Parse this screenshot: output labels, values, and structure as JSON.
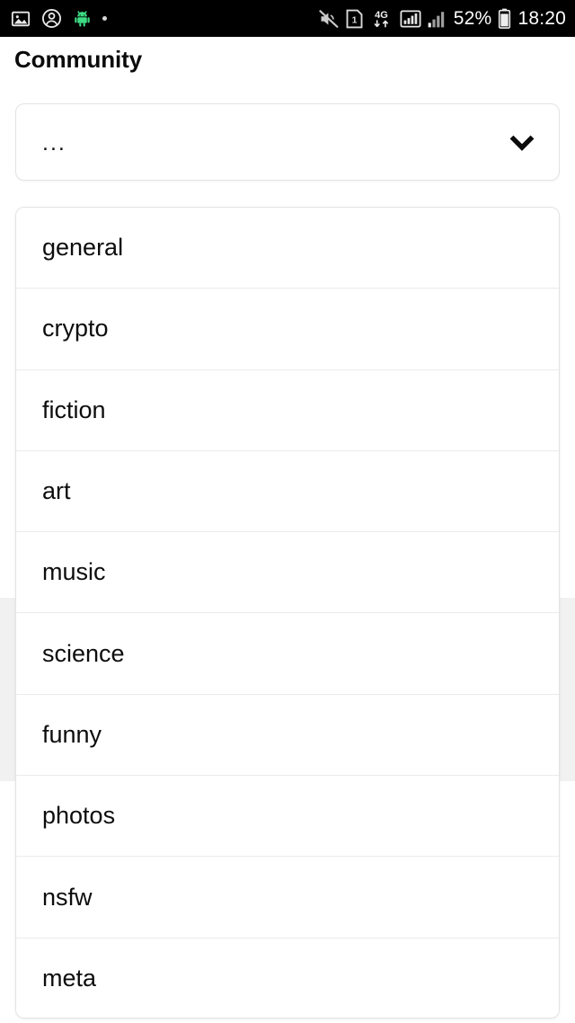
{
  "statusbar": {
    "left_icons": [
      {
        "name": "image-icon",
        "glyph": "photo"
      },
      {
        "name": "account-circle-icon",
        "glyph": "person"
      },
      {
        "name": "android-robot-icon",
        "glyph": "robot"
      },
      {
        "name": "notification-dot-icon",
        "glyph": "dot"
      }
    ],
    "right_icons": [
      {
        "name": "volume-off-icon",
        "glyph": "mute"
      },
      {
        "name": "sim-card-1-icon",
        "glyph": "sim",
        "label": "1"
      },
      {
        "name": "mobile-data-4g-icon",
        "glyph": "4g",
        "label": "4G"
      },
      {
        "name": "signal-bars-outline-icon",
        "glyph": "signal-outline"
      },
      {
        "name": "signal-bars-icon",
        "glyph": "signal"
      }
    ],
    "battery_percent": "52%",
    "battery_icon": "battery-icon",
    "clock": "18:20"
  },
  "header": {
    "title": "Community"
  },
  "select": {
    "name": "community-select",
    "value": "...",
    "chevron_icon": "chevron-down-icon"
  },
  "dropdown": {
    "name": "community-dropdown-list",
    "options": [
      {
        "label": "general"
      },
      {
        "label": "crypto"
      },
      {
        "label": "fiction"
      },
      {
        "label": "art"
      },
      {
        "label": "music"
      },
      {
        "label": "science"
      },
      {
        "label": "funny"
      },
      {
        "label": "photos"
      },
      {
        "label": "nsfw"
      },
      {
        "label": "meta"
      }
    ]
  },
  "colors": {
    "statusbar_bg": "#000000",
    "page_bg": "#ffffff",
    "card_border": "#e3e3e3",
    "row_divider": "#ebebeb",
    "behind_panel": "#f1f1f1",
    "text": "#0d0d0d",
    "robot_green": "#3ddc84"
  }
}
